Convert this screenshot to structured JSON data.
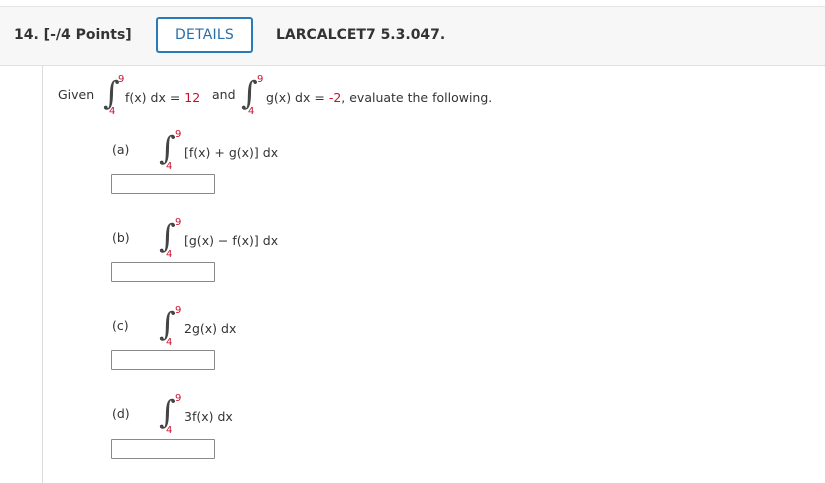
{
  "header": {
    "question_number": "14.  [-/4 Points]",
    "details_button": "DETAILS",
    "course_code": "LARCALCET7 5.3.047."
  },
  "problem": {
    "given_word": "Given",
    "int1": {
      "upper": "9",
      "lower": "4",
      "integrand": "f(x) dx = ",
      "value": "12"
    },
    "and_word": "and",
    "int2": {
      "upper": "9",
      "lower": "4",
      "integrand": "g(x) dx = ",
      "value": "-2"
    },
    "tail": ", evaluate the following."
  },
  "parts": [
    {
      "label": "(a)",
      "upper": "9",
      "lower": "4",
      "expr": "[f(x) + g(x)] dx",
      "answer": ""
    },
    {
      "label": "(b)",
      "upper": "9",
      "lower": "4",
      "expr": "[g(x) − f(x)] dx",
      "answer": ""
    },
    {
      "label": "(c)",
      "upper": "9",
      "lower": "4",
      "expr": "2g(x) dx",
      "answer": ""
    },
    {
      "label": "(d)",
      "upper": "9",
      "lower": "4",
      "expr": "3f(x) dx",
      "answer": ""
    }
  ]
}
